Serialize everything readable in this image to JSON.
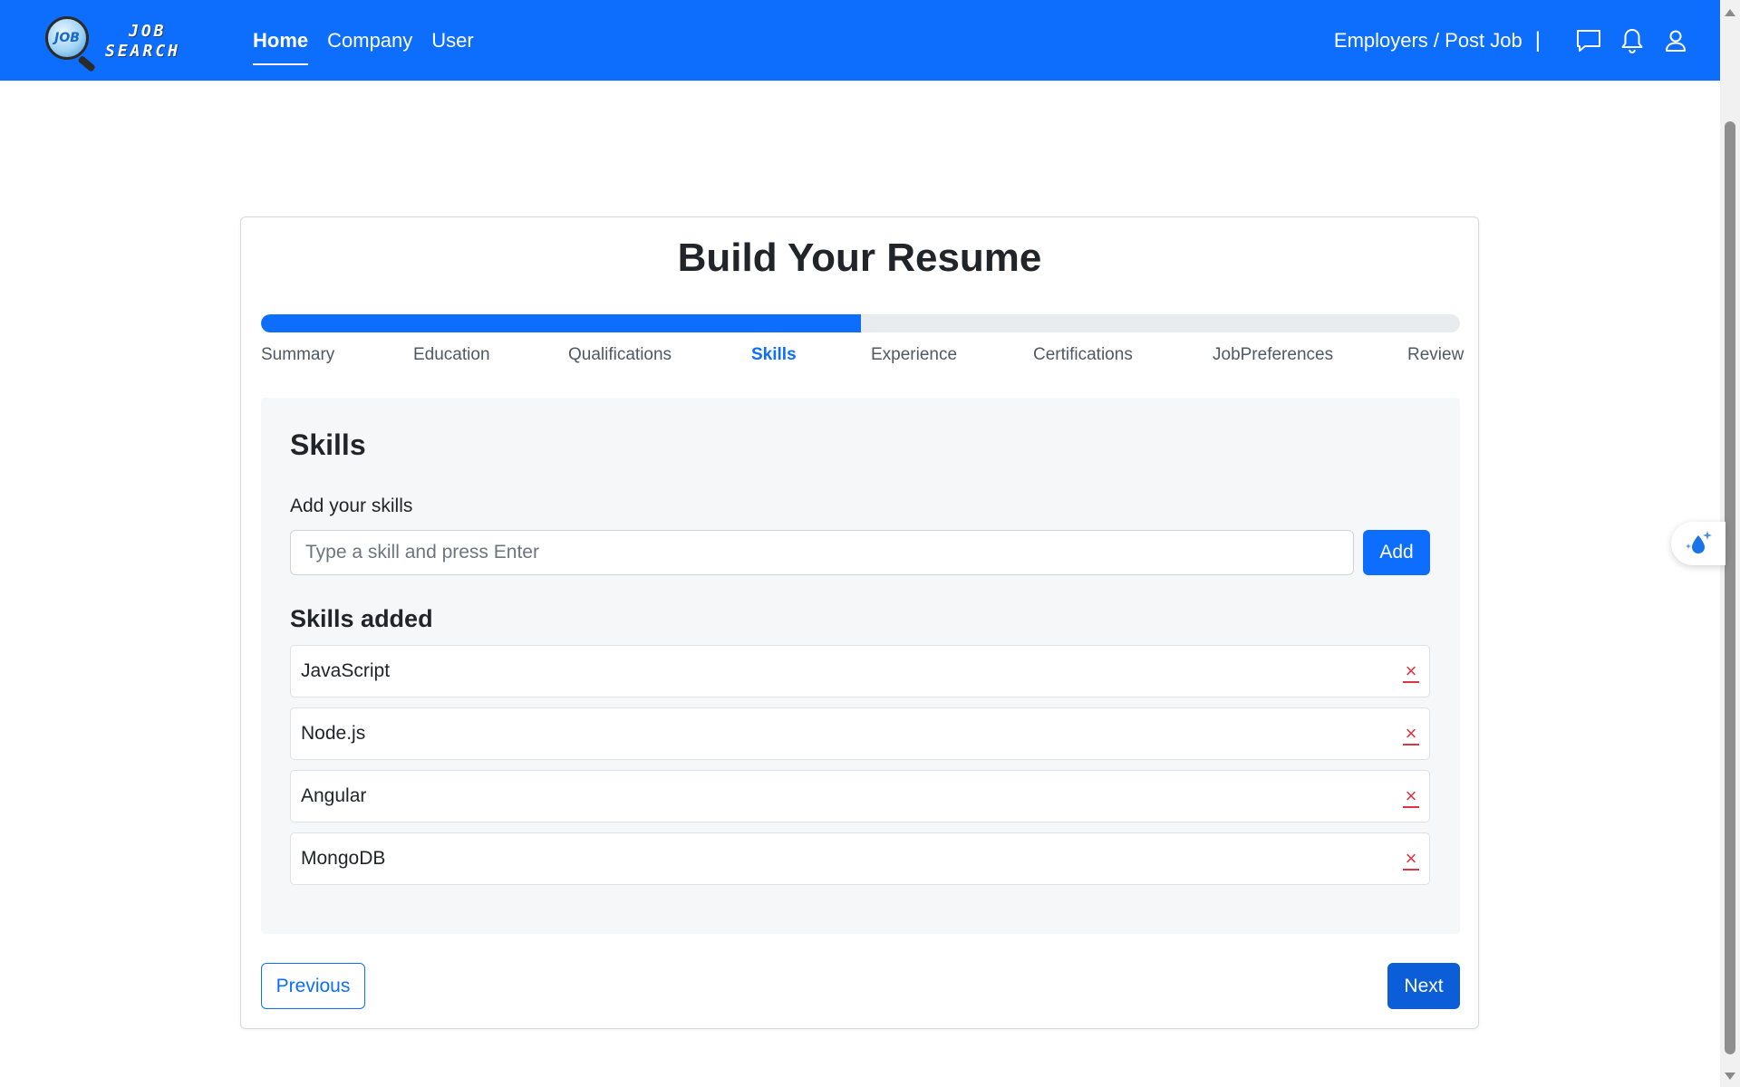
{
  "navbar": {
    "logo_top": "JOB",
    "logo_bottom": "SEARCH",
    "logo_badge": "JOB",
    "links": [
      {
        "label": "Home",
        "active": true
      },
      {
        "label": "Company",
        "active": false
      },
      {
        "label": "User",
        "active": false
      }
    ],
    "employers_label": "Employers / Post Job",
    "separator": "|",
    "icons": [
      "chat-icon",
      "bell-icon",
      "user-icon"
    ]
  },
  "card": {
    "title": "Build Your Resume",
    "progress_percent": 50,
    "steps": [
      {
        "label": "Summary",
        "active": false
      },
      {
        "label": "Education",
        "active": false
      },
      {
        "label": "Qualifications",
        "active": false
      },
      {
        "label": "Skills",
        "active": true
      },
      {
        "label": "Experience",
        "active": false
      },
      {
        "label": "Certifications",
        "active": false
      },
      {
        "label": "JobPreferences",
        "active": false
      },
      {
        "label": "Review",
        "active": false
      }
    ]
  },
  "skills_panel": {
    "title": "Skills",
    "input_label": "Add your skills",
    "input_placeholder": "Type a skill and press Enter",
    "input_value": "",
    "add_label": "Add",
    "added_title": "Skills added",
    "remove_glyph": "×",
    "skills": [
      "JavaScript",
      "Node.js",
      "Angular",
      "MongoDB"
    ]
  },
  "footer_buttons": {
    "previous_label": "Previous",
    "next_label": "Next"
  },
  "colors": {
    "primary": "#0d6efd",
    "danger": "#dc3545",
    "panel_bg": "#f6f7f9"
  }
}
